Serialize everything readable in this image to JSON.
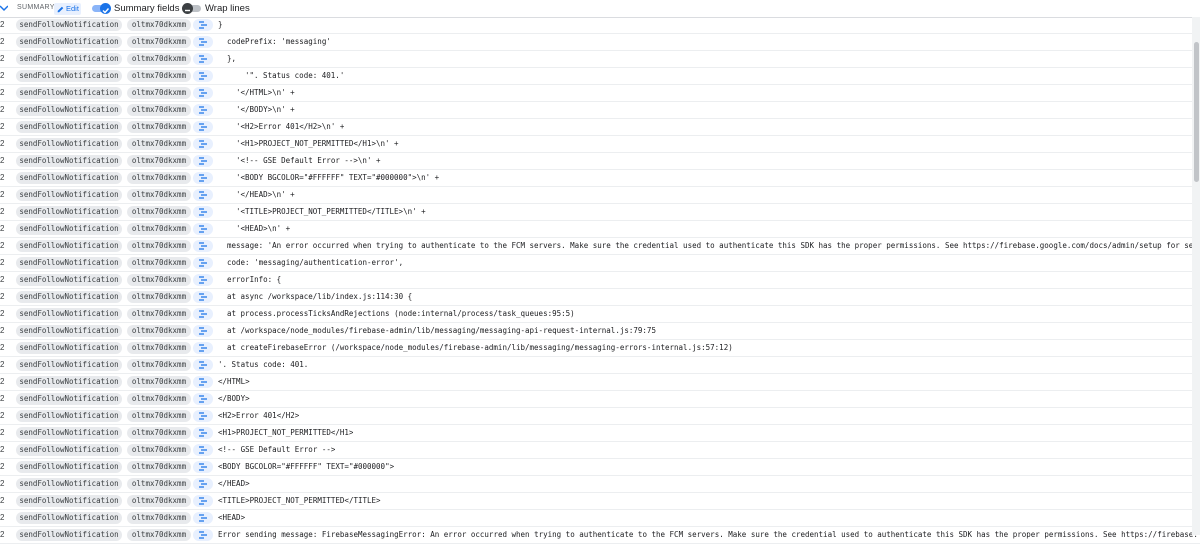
{
  "toolbar": {
    "summary_label": "SUMMARY",
    "edit_label": "Edit",
    "summary_fields_label": "Summary fields",
    "summary_fields_on": true,
    "wrap_lines_label": "Wrap lines",
    "wrap_lines_on": false
  },
  "rows": [
    {
      "severity": "2",
      "function": "sendFollowNotification",
      "execution_id": "oltmx70dkxmm",
      "message": "}",
      "indent": 0
    },
    {
      "severity": "2",
      "function": "sendFollowNotification",
      "execution_id": "oltmx70dkxmm",
      "message": "codePrefix: 'messaging'",
      "indent": 1
    },
    {
      "severity": "2",
      "function": "sendFollowNotification",
      "execution_id": "oltmx70dkxmm",
      "message": "},",
      "indent": 1
    },
    {
      "severity": "2",
      "function": "sendFollowNotification",
      "execution_id": "oltmx70dkxmm",
      "message": "'\". Status code: 401.'",
      "indent": 3
    },
    {
      "severity": "2",
      "function": "sendFollowNotification",
      "execution_id": "oltmx70dkxmm",
      "message": "'</HTML>\\n' +",
      "indent": 2
    },
    {
      "severity": "2",
      "function": "sendFollowNotification",
      "execution_id": "oltmx70dkxmm",
      "message": "'</BODY>\\n' +",
      "indent": 2
    },
    {
      "severity": "2",
      "function": "sendFollowNotification",
      "execution_id": "oltmx70dkxmm",
      "message": "'<H2>Error 401</H2>\\n' +",
      "indent": 2
    },
    {
      "severity": "2",
      "function": "sendFollowNotification",
      "execution_id": "oltmx70dkxmm",
      "message": "'<H1>PROJECT_NOT_PERMITTED</H1>\\n' +",
      "indent": 2
    },
    {
      "severity": "2",
      "function": "sendFollowNotification",
      "execution_id": "oltmx70dkxmm",
      "message": "'<!-- GSE Default Error -->\\n' +",
      "indent": 2
    },
    {
      "severity": "2",
      "function": "sendFollowNotification",
      "execution_id": "oltmx70dkxmm",
      "message": "'<BODY BGCOLOR=\"#FFFFFF\" TEXT=\"#000000\">\\n' +",
      "indent": 2
    },
    {
      "severity": "2",
      "function": "sendFollowNotification",
      "execution_id": "oltmx70dkxmm",
      "message": "'</HEAD>\\n' +",
      "indent": 2
    },
    {
      "severity": "2",
      "function": "sendFollowNotification",
      "execution_id": "oltmx70dkxmm",
      "message": "'<TITLE>PROJECT_NOT_PERMITTED</TITLE>\\n' +",
      "indent": 2
    },
    {
      "severity": "2",
      "function": "sendFollowNotification",
      "execution_id": "oltmx70dkxmm",
      "message": "'<HEAD>\\n' +",
      "indent": 2
    },
    {
      "severity": "2",
      "function": "sendFollowNotification",
      "execution_id": "oltmx70dkxmm",
      "message": "message: 'An error occurred when trying to authenticate to the FCM servers. Make sure the credential used to authenticate this SDK has the proper permissions. See https://firebase.google.com/docs/admin/setup for se…",
      "indent": 1
    },
    {
      "severity": "2",
      "function": "sendFollowNotification",
      "execution_id": "oltmx70dkxmm",
      "message": "code: 'messaging/authentication-error',",
      "indent": 1
    },
    {
      "severity": "2",
      "function": "sendFollowNotification",
      "execution_id": "oltmx70dkxmm",
      "message": "errorInfo: {",
      "indent": 1
    },
    {
      "severity": "2",
      "function": "sendFollowNotification",
      "execution_id": "oltmx70dkxmm",
      "message": "at async /workspace/lib/index.js:114:30 {",
      "indent": 1
    },
    {
      "severity": "2",
      "function": "sendFollowNotification",
      "execution_id": "oltmx70dkxmm",
      "message": "at process.processTicksAndRejections (node:internal/process/task_queues:95:5)",
      "indent": 1
    },
    {
      "severity": "2",
      "function": "sendFollowNotification",
      "execution_id": "oltmx70dkxmm",
      "message": "at /workspace/node_modules/firebase-admin/lib/messaging/messaging-api-request-internal.js:79:75",
      "indent": 1
    },
    {
      "severity": "2",
      "function": "sendFollowNotification",
      "execution_id": "oltmx70dkxmm",
      "message": "at createFirebaseError (/workspace/node_modules/firebase-admin/lib/messaging/messaging-errors-internal.js:57:12)",
      "indent": 1
    },
    {
      "severity": "2",
      "function": "sendFollowNotification",
      "execution_id": "oltmx70dkxmm",
      "message": "'. Status code: 401.",
      "indent": 0
    },
    {
      "severity": "2",
      "function": "sendFollowNotification",
      "execution_id": "oltmx70dkxmm",
      "message": "</HTML>",
      "indent": 0
    },
    {
      "severity": "2",
      "function": "sendFollowNotification",
      "execution_id": "oltmx70dkxmm",
      "message": "</BODY>",
      "indent": 0
    },
    {
      "severity": "2",
      "function": "sendFollowNotification",
      "execution_id": "oltmx70dkxmm",
      "message": "<H2>Error 401</H2>",
      "indent": 0
    },
    {
      "severity": "2",
      "function": "sendFollowNotification",
      "execution_id": "oltmx70dkxmm",
      "message": "<H1>PROJECT_NOT_PERMITTED</H1>",
      "indent": 0
    },
    {
      "severity": "2",
      "function": "sendFollowNotification",
      "execution_id": "oltmx70dkxmm",
      "message": "<!-- GSE Default Error -->",
      "indent": 0
    },
    {
      "severity": "2",
      "function": "sendFollowNotification",
      "execution_id": "oltmx70dkxmm",
      "message": "<BODY BGCOLOR=\"#FFFFFF\" TEXT=\"#000000\">",
      "indent": 0
    },
    {
      "severity": "2",
      "function": "sendFollowNotification",
      "execution_id": "oltmx70dkxmm",
      "message": "</HEAD>",
      "indent": 0
    },
    {
      "severity": "2",
      "function": "sendFollowNotification",
      "execution_id": "oltmx70dkxmm",
      "message": "<TITLE>PROJECT_NOT_PERMITTED</TITLE>",
      "indent": 0
    },
    {
      "severity": "2",
      "function": "sendFollowNotification",
      "execution_id": "oltmx70dkxmm",
      "message": "<HEAD>",
      "indent": 0
    },
    {
      "severity": "2",
      "function": "sendFollowNotification",
      "execution_id": "oltmx70dkxmm",
      "message": "Error sending message: FirebaseMessagingError: An error occurred when trying to authenticate to the FCM servers. Make sure the credential used to authenticate this SDK has the proper permissions. See https://firebase.g…",
      "indent": 0
    }
  ],
  "icons": {
    "summary_chevron": "chevron-down-icon",
    "edit": "pencil-icon",
    "row_summary_fields": "summary-fields-icon"
  },
  "colors": {
    "accent": "#1a73e8",
    "chip_bg": "#e8eaed",
    "icon_chip_bg": "#e8f0fe"
  }
}
